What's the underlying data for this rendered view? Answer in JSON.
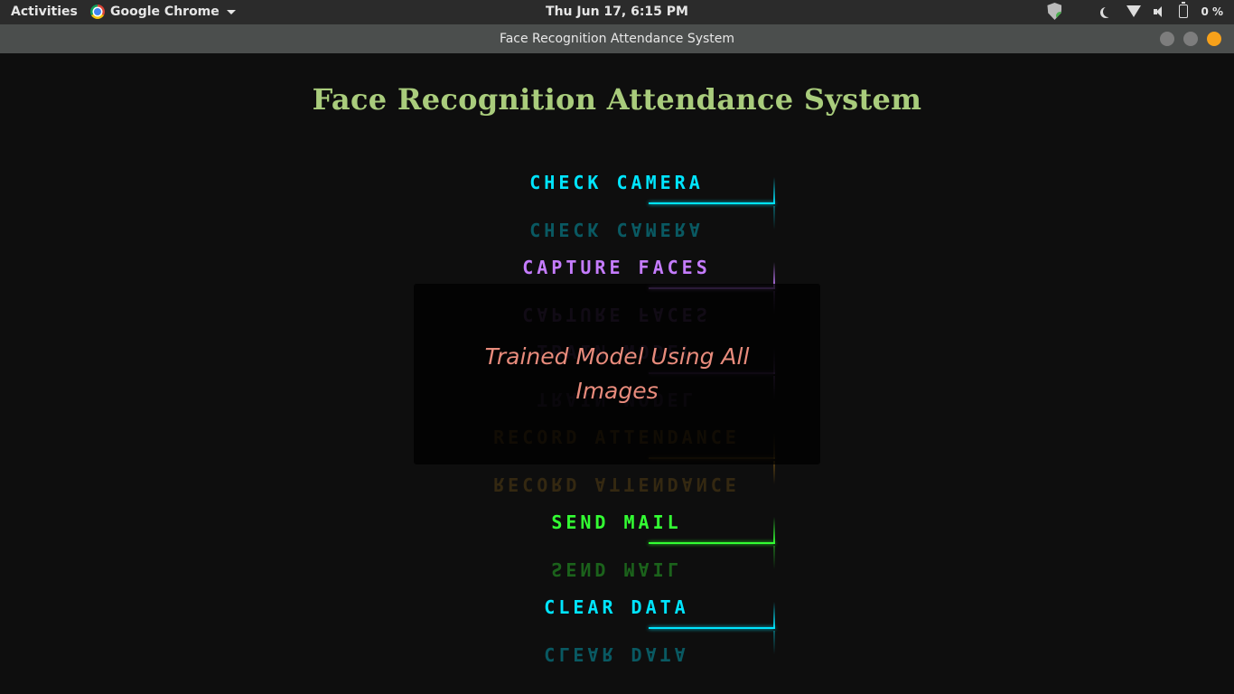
{
  "topbar": {
    "activities": "Activities",
    "app_name": "Google Chrome",
    "clock": "Thu Jun 17,  6:15 PM",
    "battery": "0 %"
  },
  "window": {
    "title": "Face Recognition Attendance System"
  },
  "app": {
    "heading": "Face Recognition Attendance System",
    "buttons": [
      {
        "label": "CHECK CAMERA",
        "color": "#00e5ff",
        "dim": false
      },
      {
        "label": "CAPTURE FACES",
        "color": "#c57cff",
        "dim": false
      },
      {
        "label": "TRAIN MODEL",
        "color": "#c57cff",
        "dim": true
      },
      {
        "label": "RECORD ATTENDANCE",
        "color": "#e0a020",
        "dim": true
      },
      {
        "label": "SEND MAIL",
        "color": "#33ff33",
        "dim": false
      },
      {
        "label": "CLEAR DATA",
        "color": "#00e5ff",
        "dim": false
      }
    ]
  },
  "modal": {
    "message": "Trained Model Using All Images"
  }
}
